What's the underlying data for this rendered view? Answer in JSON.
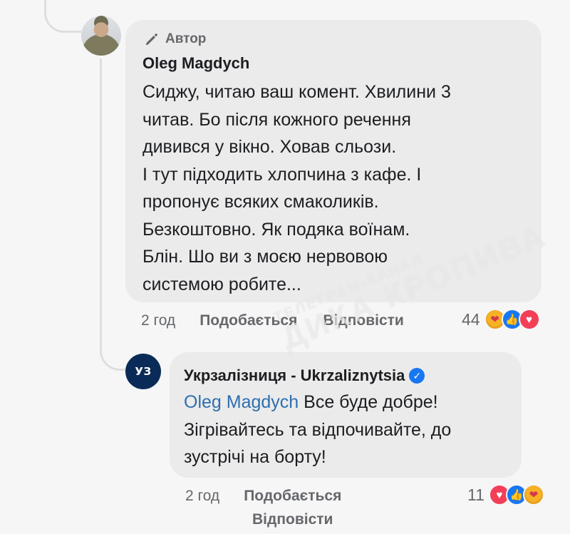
{
  "comment1": {
    "badge_label": "Автор",
    "author": "Oleg Magdych",
    "text": "Сиджу, читаю ваш комент. Хвилини 3\nчитав. Бо після кожного речення\nдивився у вікно. Ховав сльози.\nІ тут підходить хлопчина з кафе. І\nпропонує всяких смаколиків.\nБезкоштовно. Як подяка воїнам.\nБлін. Шо ви з моєю нервовою\nсистемою робите...",
    "time": "2 год",
    "like_label": "Подобається",
    "reply_label": "Відповісти",
    "reaction_count": "44",
    "reactions": [
      "care-icon",
      "like-icon",
      "love-icon"
    ]
  },
  "comment2": {
    "avatar_text": "УЗ",
    "author": "Укрзалізниця - Ukrzaliznytsia",
    "verified": true,
    "mention": "Oleg Magdych",
    "text": " Все буде добре!\nЗігрівайтесь та відпочивайте, до\nзустрічі на борту!",
    "time": "2 год",
    "like_label": "Подобається",
    "reply_label": "Відповісти",
    "reaction_count": "11",
    "reactions": [
      "love-icon",
      "like-icon",
      "care-icon"
    ]
  },
  "watermark": {
    "line1": "ТЕЛЕГРАМ-КАНАЛ",
    "line2": "ДИКА КРОПИВА"
  },
  "colors": {
    "background": "#f6f6f6",
    "bubble": "#ebebeb",
    "mention": "#2e6fb0",
    "verified": "#1877f2",
    "uz_brand": "#0a2b57"
  }
}
